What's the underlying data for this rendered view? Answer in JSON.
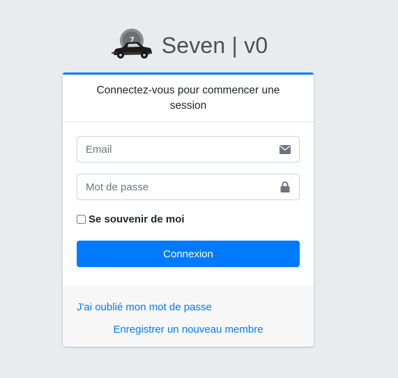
{
  "brand": {
    "title": "Seven | v0",
    "logo_icon": "vintage-car-logo"
  },
  "login": {
    "message": "Connectez-vous pour commencer une session",
    "email_placeholder": "Email",
    "email_icon": "envelope-icon",
    "password_placeholder": "Mot de passe",
    "password_icon": "lock-icon",
    "remember_label": "Se souvenir de moi",
    "submit_label": "Connexion",
    "forgot_link": "J'ai oublié mon mot de passe",
    "register_link": "Enregistrer un nouveau membre"
  },
  "colors": {
    "accent": "#007bff",
    "background": "#e9ecef",
    "icon": "#6c757d"
  }
}
